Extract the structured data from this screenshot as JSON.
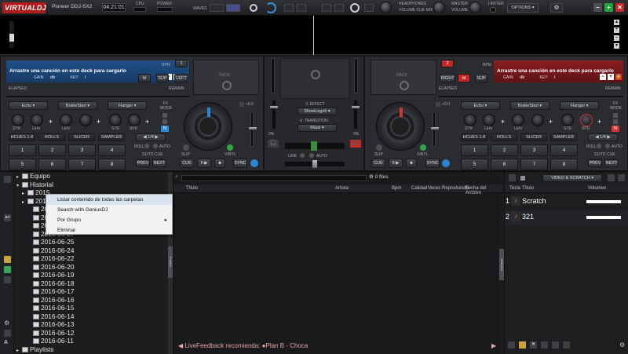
{
  "app": {
    "logo_text": "VIRTUALDJ",
    "controller": "Pioneer DDJ-SX2",
    "clock": "04:21:01",
    "cpu_label": "CPU",
    "power_label": "POWER",
    "waves_label": "WAVES",
    "headphones_label": "HEADPHONES",
    "headphones_sub": "VOLUME   CUE MIX",
    "master_label": "MASTER",
    "master_sub": "VOLUME",
    "limiter_label": "LIMITER",
    "options_label": "OPTIONS"
  },
  "deck_left": {
    "load_text": "Arrastre una canción en este deck para cargarlo",
    "gain_label": "GAIN:",
    "gain_value": "db",
    "key_label": "KEY:",
    "key_value": "/",
    "bpm_label": "BPM",
    "deck_number": "1",
    "btn_m": "M",
    "btn_sup": "SUP",
    "btn_side": "LEFT",
    "elapsed": "ELAPSED",
    "remain": "REMAIN",
    "deck_badge": "DECK",
    "fx": [
      "Echo",
      "BrakeStart",
      "Flanger"
    ],
    "fx_mode": "FX MODE",
    "knob_labels": [
      "STR",
      "LEN",
      "LEN",
      "STR",
      "SPD"
    ],
    "pad_modes": [
      "HCUES 1-8",
      "ROLLS",
      "SLICER",
      "SAMPLER"
    ],
    "loop_label": "1/4",
    "roll_label": "ROLL",
    "auto_label": "AUTO",
    "goto_cue": "GOTO CUE",
    "prev": "PREV",
    "next": "NEXT",
    "pads": [
      "1",
      "2",
      "3",
      "4",
      "5",
      "6",
      "7",
      "8"
    ],
    "pitch_value": "+0.0",
    "slip_label": "SLIP",
    "vinyl_label": "VINYL",
    "cue": "CUE",
    "play": "II ▶",
    "sync": "SYNC"
  },
  "deck_right": {
    "load_text": "Arrastre una canción en este deck para cargarlo",
    "gain_label": "GAIN:",
    "gain_value": "db",
    "key_label": "KEY:",
    "key_value": "/",
    "bpm_label": "BPM",
    "deck_number": "2",
    "btn_m": "M",
    "btn_sup": "SUP",
    "btn_side": "RIGHT",
    "elapsed": "ELAPSED",
    "remain": "REMAIN",
    "deck_badge": "DECK",
    "fx": [
      "Echo",
      "BrakeStart",
      "Flanger"
    ],
    "fx_mode": "FX MODE",
    "knob_labels": [
      "STR",
      "LEN",
      "LEN",
      "STR",
      "SPD"
    ],
    "pad_modes": [
      "HCUES 1-8",
      "ROLLS",
      "SLICER",
      "SAMPLER"
    ],
    "loop_label": "1/4",
    "roll_label": "ROLL",
    "auto_label": "AUTO",
    "goto_cue": "GOTO CUE",
    "prev": "PREV",
    "next": "NEXT",
    "pads": [
      "1",
      "2",
      "3",
      "4",
      "5",
      "6",
      "7",
      "8"
    ],
    "pitch_value": "+0.0",
    "slip_label": "SLIP",
    "vinyl_label": "VINYL",
    "cue": "CUE",
    "play": "II ▶",
    "sync": "SYNC"
  },
  "mixer": {
    "v_effect_label": "V. EFFECT",
    "v_effect_value": "ShowLogo6",
    "v_transition_label": "V. TRANSITION",
    "v_transition_value": "Mask",
    "link_label": "LINK",
    "auto_label": "AUTO",
    "pct_left": "0%",
    "pct_right": "0%"
  },
  "browser": {
    "search_placeholder": "",
    "files_count": "0 files",
    "columns": [
      "Título",
      "Artista",
      "Bpm",
      "Calidad",
      "Veces Reproducida",
      "Fecha del Archivo"
    ],
    "tree": [
      {
        "label": "Equipo",
        "indent": 1,
        "expander": "▸"
      },
      {
        "label": "Historial",
        "indent": 1,
        "expander": "▾"
      },
      {
        "label": "2015",
        "indent": 2,
        "expander": "▸"
      },
      {
        "label": "2016",
        "indent": 2,
        "expander": "▸"
      },
      {
        "label": "2016-06-30",
        "indent": 3,
        "expander": ""
      },
      {
        "label": "2016-06-29",
        "indent": 3,
        "expander": ""
      },
      {
        "label": "2016-06-28",
        "indent": 3,
        "expander": ""
      },
      {
        "label": "2016-06-27",
        "indent": 3,
        "expander": ""
      },
      {
        "label": "2016-06-25",
        "indent": 3,
        "expander": ""
      },
      {
        "label": "2016-06-24",
        "indent": 3,
        "expander": ""
      },
      {
        "label": "2016-06-22",
        "indent": 3,
        "expander": ""
      },
      {
        "label": "2016-06-20",
        "indent": 3,
        "expander": ""
      },
      {
        "label": "2016-06-19",
        "indent": 3,
        "expander": ""
      },
      {
        "label": "2016-06-18",
        "indent": 3,
        "expander": ""
      },
      {
        "label": "2016-06-17",
        "indent": 3,
        "expander": ""
      },
      {
        "label": "2016-06-16",
        "indent": 3,
        "expander": ""
      },
      {
        "label": "2016-06-15",
        "indent": 3,
        "expander": ""
      },
      {
        "label": "2016-06-14",
        "indent": 3,
        "expander": ""
      },
      {
        "label": "2016-06-13",
        "indent": 3,
        "expander": ""
      },
      {
        "label": "2016-06-12",
        "indent": 3,
        "expander": ""
      },
      {
        "label": "2016-06-11",
        "indent": 3,
        "expander": ""
      },
      {
        "label": "Playlists",
        "indent": 1,
        "expander": "▸"
      }
    ],
    "context_menu": [
      "Listar contenido de todas las carpetas",
      "Search with GeniusDJ",
      "Por Grupo",
      "Eliminar"
    ],
    "sideview_tab": "Sideview",
    "folders_tab": "Folders",
    "live_feedback": "◀ LiveFeedback recomienda: ●Plan B - Choca",
    "live_feedback_next": "▶"
  },
  "sampler": {
    "dropdown": "VIDEO & SCRATCH",
    "columns": [
      "Tecla",
      "Título",
      "Volumen"
    ],
    "items": [
      {
        "key": "1",
        "title": "Scratch"
      },
      {
        "key": "2",
        "title": "321"
      }
    ]
  },
  "colors": {
    "deck_left": "#1f4f86",
    "deck_right": "#8a1f22",
    "accent_blue": "#2a86d6",
    "accent_red": "#d23434"
  }
}
